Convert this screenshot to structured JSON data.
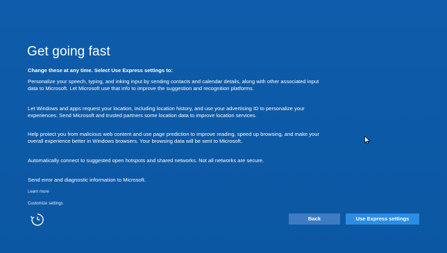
{
  "page": {
    "title": "Get going fast",
    "subtitle": "Change these at any time. Select Use Express settings to:",
    "paragraphs": [
      "Personalize your speech, typing, and inking input by sending contacts and calendar details, along with other associated input data to Microsoft. Let Microsoft use that info to improve the suggestion and recognition platforms.",
      "Let Windows and apps request your location, including location history, and use your advertising ID to personalize your experiences. Send Microsoft and trusted partners some location data to improve location services.",
      "Help protect you from malicious web content and use page prediction to improve reading, speed up browsing, and make your overall experience better in Windows browsers. Your browsing data will be sent to Microsoft.",
      "Automatically connect to suggested open hotspots and shared networks. Not all networks are secure.",
      "Send error and diagnostic information to Microsoft."
    ],
    "links": {
      "learn_more": "Learn more",
      "customize": "Customize settings"
    }
  },
  "buttons": {
    "back": "Back",
    "express": "Use Express settings"
  },
  "icons": {
    "ease_of_access": "ease-of-access-icon",
    "cursor": "mouse-pointer-icon"
  },
  "colors": {
    "background": "#0d5aa7",
    "back_button": "#3e7bc2",
    "express_button": "#2b8de3",
    "text": "#ffffff"
  }
}
